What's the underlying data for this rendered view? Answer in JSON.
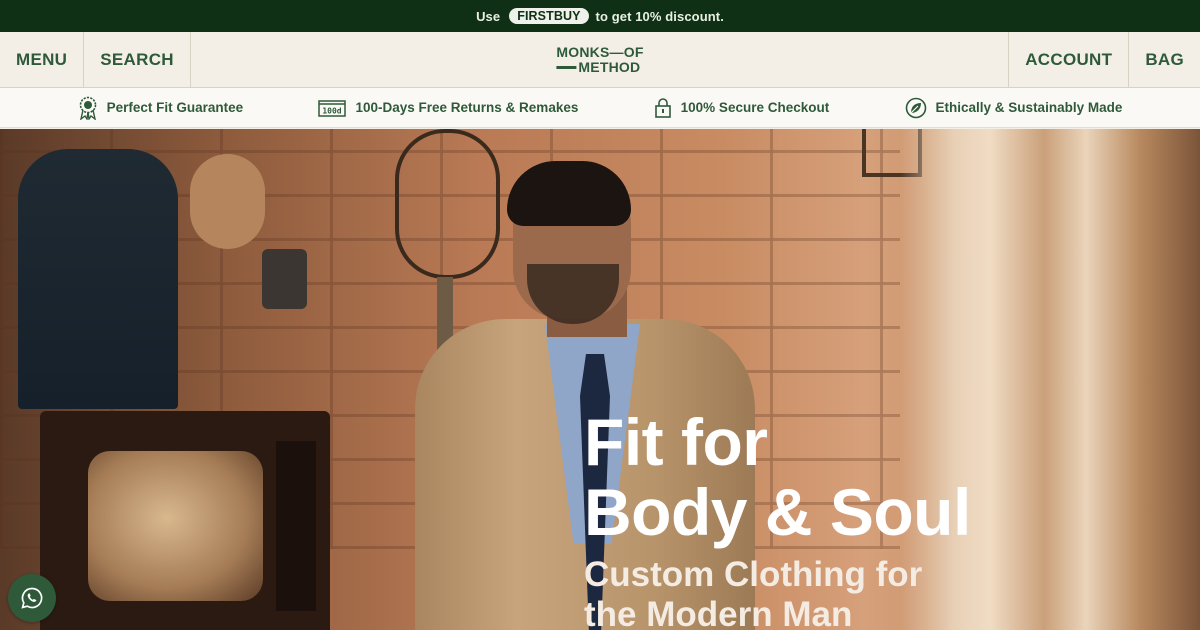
{
  "announcement": {
    "prefix": "Use",
    "code": "FIRSTBUY",
    "suffix": "to get 10% discount."
  },
  "header": {
    "menu_label": "MENU",
    "search_label": "SEARCH",
    "logo_line1": "MONKS—OF",
    "logo_line2": "METHOD",
    "account_label": "ACCOUNT",
    "bag_label": "BAG"
  },
  "usp": [
    {
      "icon": "rosette-icon",
      "label": "Perfect Fit Guarantee"
    },
    {
      "icon": "100d-returns-icon",
      "label": "100-Days Free Returns & Remakes"
    },
    {
      "icon": "lock-icon",
      "label": "100% Secure Checkout"
    },
    {
      "icon": "leaf-icon",
      "label": "Ethically & Sustainably Made"
    }
  ],
  "usp_badge_text": "100d",
  "hero": {
    "title_line1": "Fit for",
    "title_line2": "Body & Soul",
    "subtitle_line1": "Custom Clothing for",
    "subtitle_line2": "the Modern Man"
  },
  "colors": {
    "brand_green": "#2f5a3a",
    "announce_bg": "#0f3015",
    "header_bg": "#f3efe7"
  },
  "whatsapp": {
    "icon": "whatsapp-icon"
  }
}
